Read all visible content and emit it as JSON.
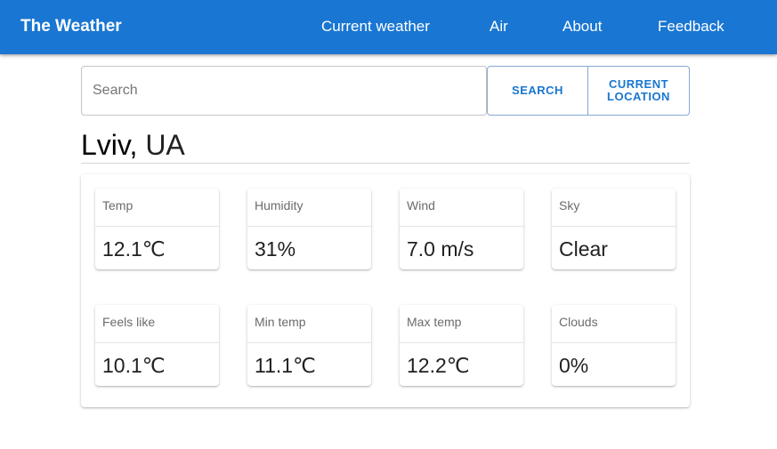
{
  "appbar": {
    "brand": "The Weather",
    "nav": [
      "Current weather",
      "Air",
      "About",
      "Feedback"
    ]
  },
  "search": {
    "placeholder": "Search",
    "value": "",
    "search_button": "SEARCH",
    "location_button": "CURRENT LOCATION"
  },
  "location": {
    "city": "Lviv,",
    "country": "UA"
  },
  "stats": [
    {
      "label": "Temp",
      "value": "12.1℃"
    },
    {
      "label": "Humidity",
      "value": "31%"
    },
    {
      "label": "Wind",
      "value": "7.0 m/s"
    },
    {
      "label": "Sky",
      "value": "Clear"
    },
    {
      "label": "Feels like",
      "value": "10.1℃"
    },
    {
      "label": "Min temp",
      "value": "11.1℃"
    },
    {
      "label": "Max temp",
      "value": "12.2℃"
    },
    {
      "label": "Clouds",
      "value": "0%"
    }
  ],
  "colors": {
    "primary": "#1976d2",
    "button_border": "#86a9d6"
  }
}
